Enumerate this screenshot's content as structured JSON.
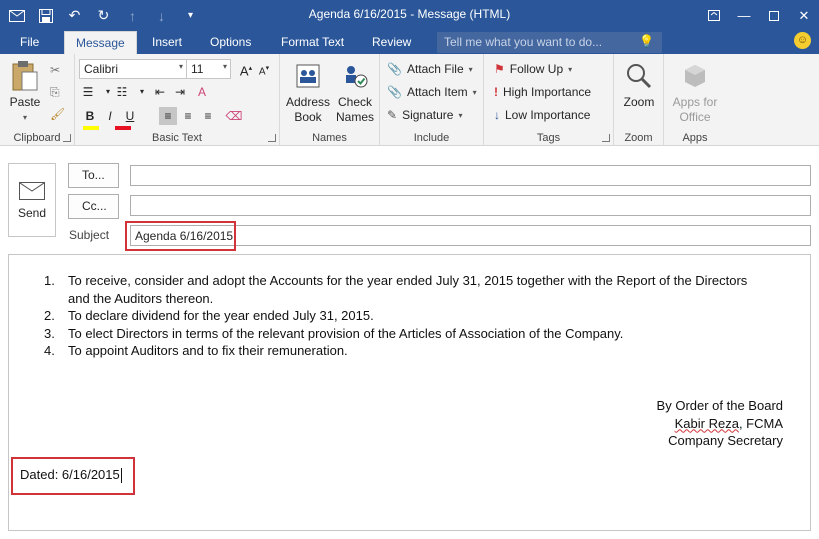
{
  "window": {
    "title": "Agenda 6/16/2015 - Message (HTML)"
  },
  "tabs": [
    {
      "label": "File"
    },
    {
      "label": "Message"
    },
    {
      "label": "Insert"
    },
    {
      "label": "Options"
    },
    {
      "label": "Format Text"
    },
    {
      "label": "Review"
    }
  ],
  "active_tab": "Message",
  "tell_me": {
    "placeholder": "Tell me what you want to do..."
  },
  "ribbon": {
    "clipboard": {
      "group_label": "Clipboard",
      "paste_label": "Paste"
    },
    "basic_text": {
      "group_label": "Basic Text",
      "font_name": "Calibri",
      "font_size": "11",
      "bold": "B",
      "italic": "I",
      "underline": "U",
      "grow": "A",
      "shrink": "A"
    },
    "names": {
      "group_label": "Names",
      "address_book": "Address Book",
      "check_names": "Check Names"
    },
    "include": {
      "group_label": "Include",
      "attach_file": "Attach File",
      "attach_item": "Attach Item",
      "signature": "Signature"
    },
    "tags": {
      "group_label": "Tags",
      "follow_up": "Follow Up",
      "high_importance": "High Importance",
      "low_importance": "Low Importance"
    },
    "zoom": {
      "group_label": "Zoom",
      "zoom_label": "Zoom"
    },
    "apps": {
      "group_label": "Apps",
      "apps_label": "Apps for Office"
    }
  },
  "compose": {
    "send_label": "Send",
    "to_label": "To...",
    "cc_label": "Cc...",
    "subject_label": "Subject",
    "to_value": "",
    "cc_value": "",
    "subject_value": "Agenda 6/16/2015"
  },
  "message_body": {
    "agenda_items": [
      {
        "number": "1.",
        "line1": "To receive, consider and adopt the Accounts for the year ended July 31, 2015 together with the Report of the Directors",
        "line2": "and the Auditors thereon."
      },
      {
        "number": "2.",
        "line1": "To declare dividend for the year ended July 31, 2015."
      },
      {
        "number": "3.",
        "line1": "To elect Directors in terms of the relevant provision of the Articles of Association of the Company."
      },
      {
        "number": "4.",
        "line1": "To appoint Auditors and to fix their remuneration."
      }
    ],
    "signature": {
      "line1": "By Order of the Board",
      "name": "Kabir Reza",
      "name_suffix": ", FCMA",
      "line3": "Company Secretary"
    },
    "dated": "Dated: 6/16/2015"
  },
  "colors": {
    "titlebar": "#2b579a",
    "highlight_box": "#d13438",
    "ribbon_bg": "#f3f3f3"
  }
}
